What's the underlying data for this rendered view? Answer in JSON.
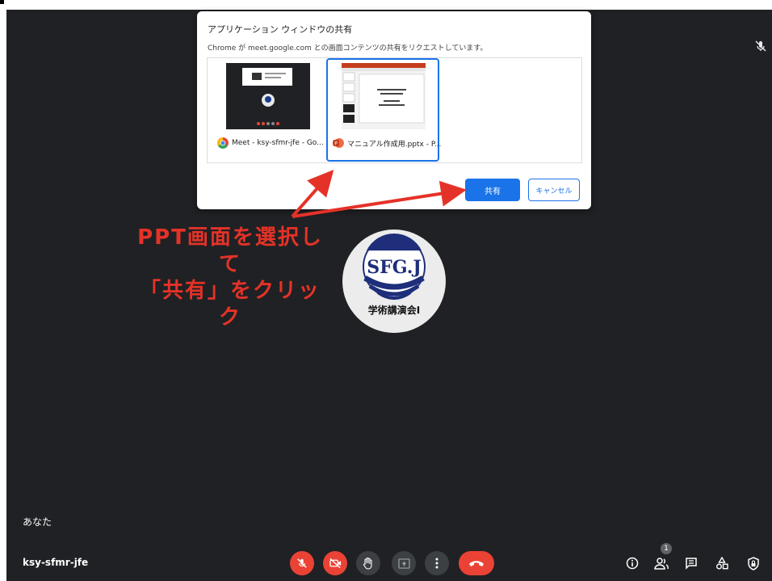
{
  "dialog": {
    "title": "アプリケーション ウィンドウの共有",
    "subtitle": "Chrome が meet.google.com との画面コンテンツの共有をリクエストしています。",
    "windows": [
      {
        "label": "Meet - ksy-sfmr-jfe - Go...",
        "icon": "chrome-icon",
        "selected": false
      },
      {
        "label": "マニュアル作成用.pptx - P...",
        "icon": "powerpoint-icon",
        "selected": true
      }
    ],
    "share_label": "共有",
    "cancel_label": "キャンセル"
  },
  "annotation": {
    "line1": "PPT画面を選択して",
    "line2": "「共有」をクリック"
  },
  "avatar": {
    "logo_text": "SFG.J",
    "caption": "学術講演会Ⅰ"
  },
  "self_label": "あなた",
  "meeting_code": "ksy-sfmr-jfe",
  "participants_count": "1",
  "colors": {
    "background": "#202124",
    "accent": "#1a73e8",
    "danger": "#ea4335",
    "annotation": "#e53228"
  },
  "controls": [
    "mic-off-icon",
    "camera-off-icon",
    "raise-hand-icon",
    "present-icon",
    "more-options-icon",
    "end-call-icon"
  ],
  "right_controls": [
    "info-icon",
    "people-icon",
    "chat-icon",
    "activities-icon",
    "host-controls-icon"
  ]
}
